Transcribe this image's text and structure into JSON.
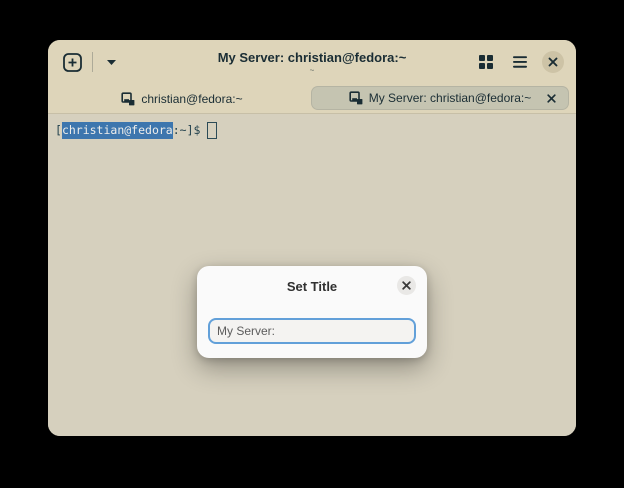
{
  "window": {
    "title": "My Server: christian@fedora:~",
    "subtitle": "~"
  },
  "tabs": [
    {
      "label": "christian@fedora:~"
    },
    {
      "label": "My Server: christian@fedora:~"
    }
  ],
  "terminal": {
    "prompt_prefix": "[",
    "selected_text": "christian@fedora",
    "prompt_suffix": ":~]$"
  },
  "dialog": {
    "title": "Set Title",
    "input_value": "My Server:"
  },
  "colors": {
    "header_bg": "#ded5ba",
    "terminal_bg": "#d6d0be",
    "active_tab_bg": "#c5c4b1",
    "foreground": "#1a2d34",
    "selection_bg": "#3d76ae",
    "dialog_bg": "#fafafa",
    "input_focus_border": "#62a0d9"
  }
}
